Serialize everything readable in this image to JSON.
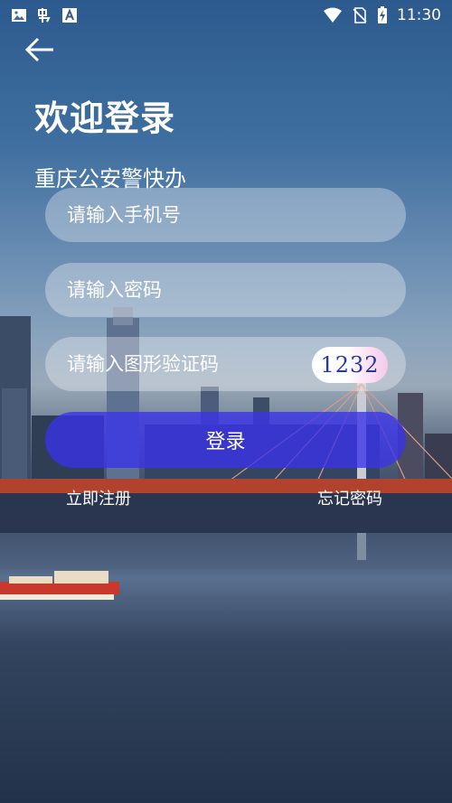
{
  "status_bar": {
    "time": "11:30",
    "left_icons": [
      "image-icon",
      "app-icon",
      "font-icon"
    ],
    "right_icons": [
      "wifi-icon",
      "no-sim-icon",
      "battery-charging-icon"
    ]
  },
  "header": {
    "back_icon": "arrow-left-icon",
    "title": "欢迎登录",
    "subtitle": "重庆公安警快办"
  },
  "form": {
    "phone_placeholder": "请输入手机号",
    "password_placeholder": "请输入密码",
    "captcha_placeholder": "请输入图形验证码",
    "captcha_code": "1232",
    "login_label": "登录"
  },
  "links": {
    "register": "立即注册",
    "forgot_password": "忘记密码"
  },
  "colors": {
    "login_button": "#3a32eb",
    "captcha_text": "#2637a8",
    "input_fill": "rgba(255,255,255,0.32)"
  }
}
